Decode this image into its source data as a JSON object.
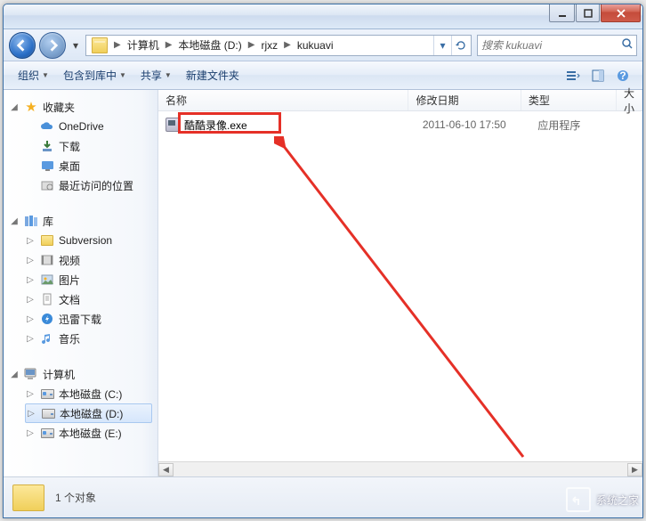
{
  "breadcrumbs": [
    "计算机",
    "本地磁盘 (D:)",
    "rjxz",
    "kukuavi"
  ],
  "search": {
    "placeholder": "搜索 kukuavi"
  },
  "toolbar": {
    "organize": "组织",
    "include": "包含到库中",
    "share": "共享",
    "newfolder": "新建文件夹"
  },
  "columns": {
    "name": "名称",
    "date": "修改日期",
    "type": "类型",
    "size": "大小"
  },
  "sidebar": {
    "favorites": {
      "title": "收藏夹",
      "items": [
        "OneDrive",
        "下载",
        "桌面",
        "最近访问的位置"
      ]
    },
    "libraries": {
      "title": "库",
      "items": [
        "Subversion",
        "视频",
        "图片",
        "文档",
        "迅雷下载",
        "音乐"
      ]
    },
    "computer": {
      "title": "计算机",
      "items": [
        "本地磁盘 (C:)",
        "本地磁盘 (D:)",
        "本地磁盘 (E:)"
      ]
    }
  },
  "files": [
    {
      "name": "酷酷录像.exe",
      "date": "2011-06-10 17:50",
      "type": "应用程序",
      "size": ""
    }
  ],
  "status": {
    "count_label": "1 个对象"
  },
  "watermark": "系统之家"
}
